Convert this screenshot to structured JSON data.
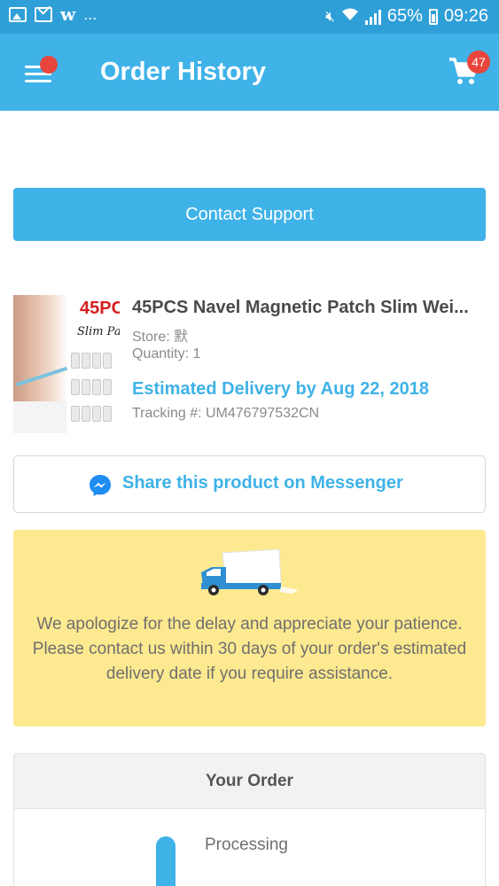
{
  "status_bar": {
    "icons": [
      "image-icon",
      "mail-icon",
      "wish-app-icon"
    ],
    "app_glyph": "w",
    "more": "...",
    "battery_percent": "65%",
    "time": "09:26"
  },
  "app_bar": {
    "title": "Order History",
    "menu_has_notification": true,
    "cart_count": "47"
  },
  "contact_support": {
    "label": "Contact Support"
  },
  "product": {
    "image_title": "45PC",
    "image_subtitle": "Slim Pa",
    "name": "45PCS Navel Magnetic Patch Slim Wei...",
    "store": "Store: 默",
    "quantity": "Quantity: 1",
    "estimated_delivery": "Estimated Delivery by Aug 22, 2018",
    "tracking": "Tracking #: UM476797532CN"
  },
  "messenger": {
    "label": "Share this product on Messenger"
  },
  "notice": {
    "message": "We apologize for the delay and appreciate your patience. Please contact us within 30 days of your order's estimated delivery date if you require assistance."
  },
  "your_order": {
    "title": "Your Order",
    "steps": [
      {
        "label": "Processing"
      }
    ]
  },
  "colors": {
    "status_bar": "#2f9fd8",
    "app_bar": "#3fb2e8",
    "accent": "#3fb2e8",
    "badge": "#e8453c",
    "notice_bg": "#fde98f"
  }
}
